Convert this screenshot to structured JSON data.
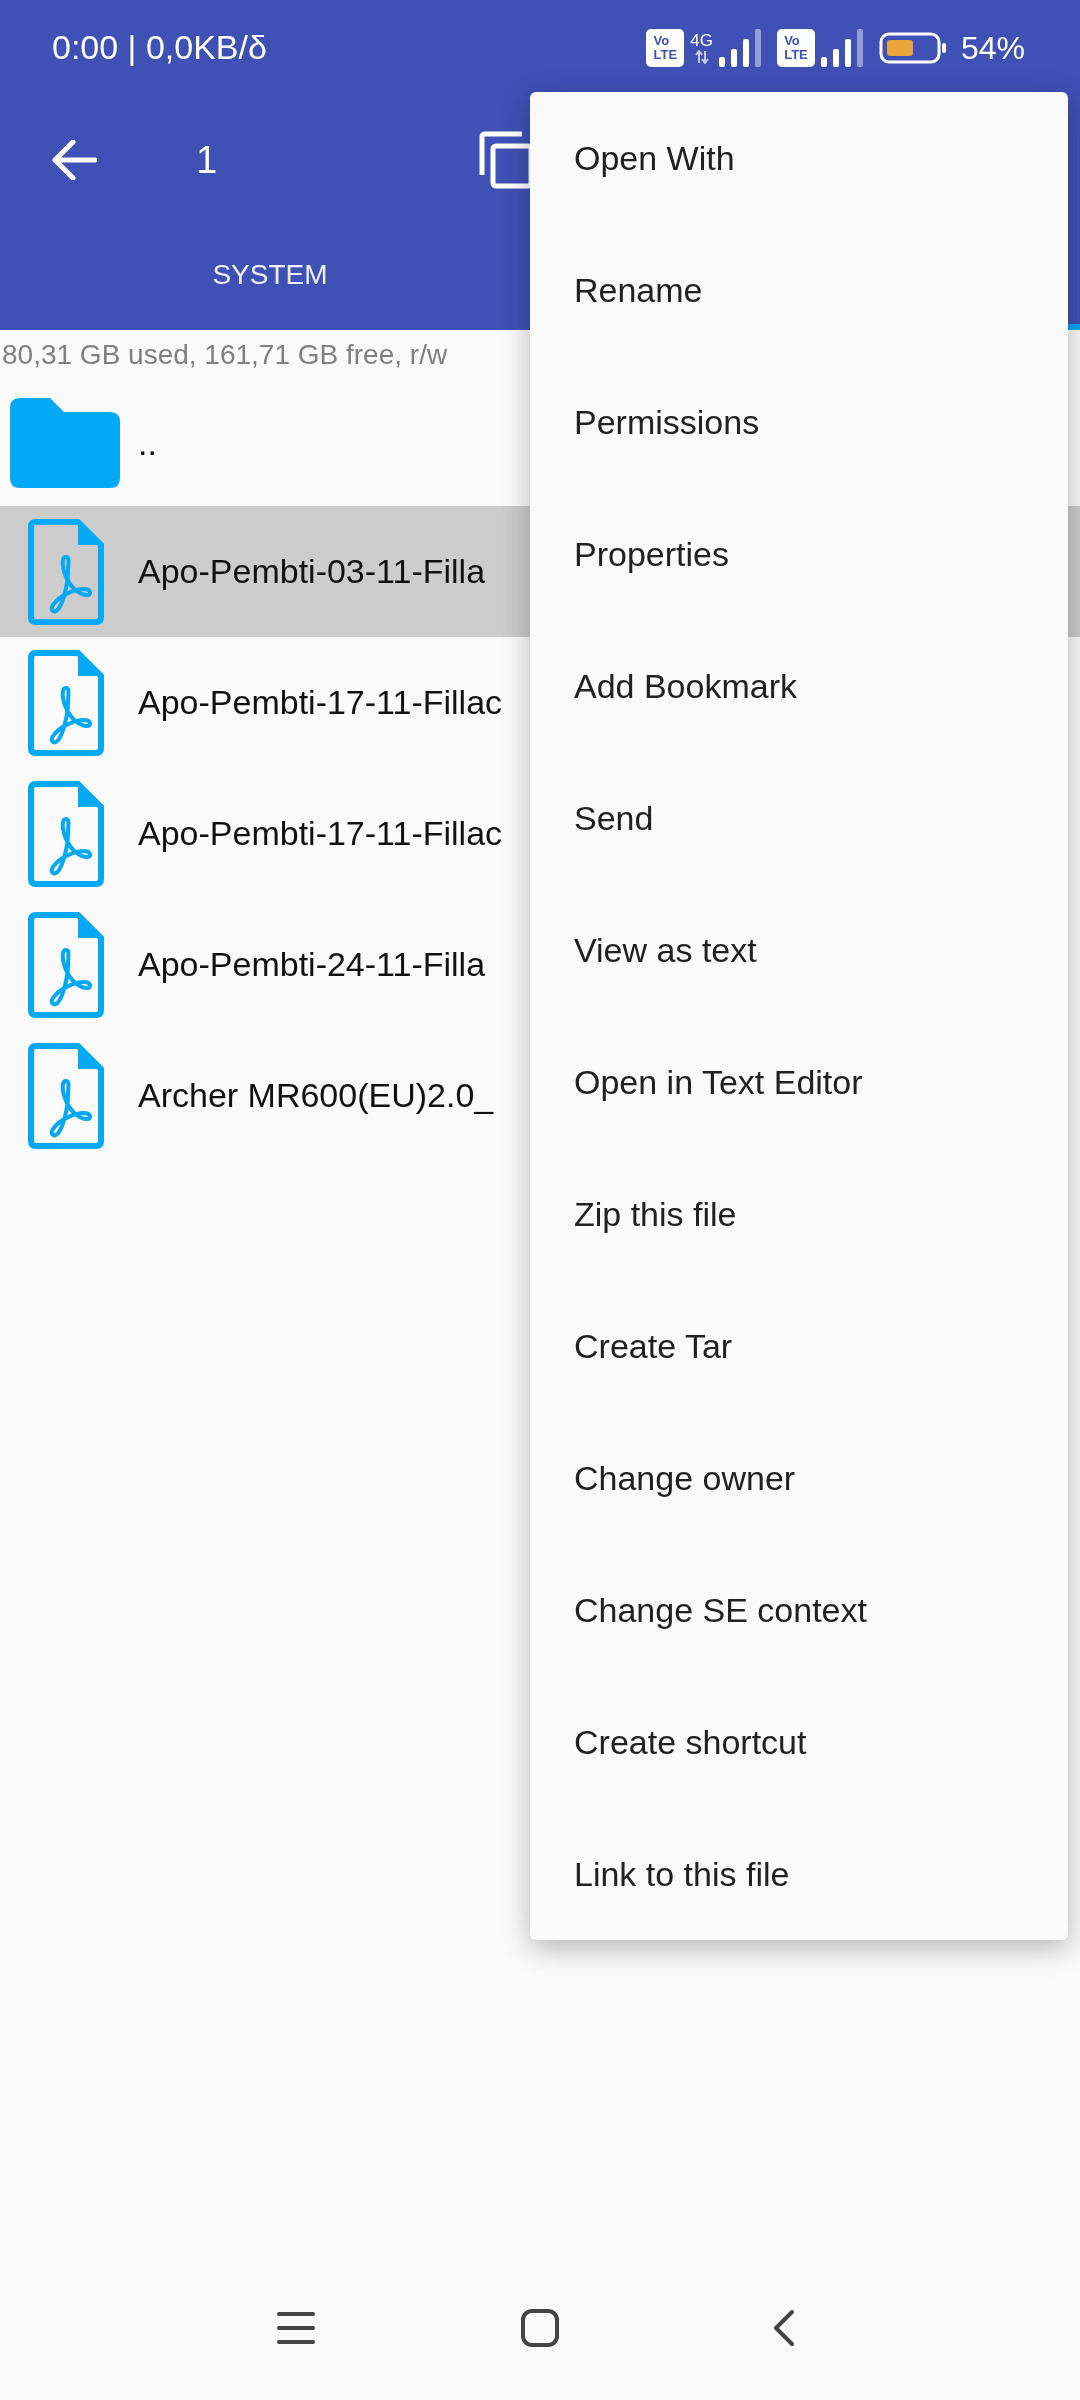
{
  "status_bar": {
    "time_speed": "0:00 | 0,0KB/δ",
    "sims": [
      {
        "badge": [
          "Vo",
          "LTE"
        ],
        "network": "4G"
      },
      {
        "badge": [
          "Vo",
          "LTE"
        ]
      }
    ],
    "battery": "54%"
  },
  "toolbar": {
    "title": "1"
  },
  "tabs": [
    {
      "label": "SYSTEM",
      "selected": false
    },
    {
      "selected": true
    }
  ],
  "file_list": {
    "storage_info": "80,31 GB used, 161,71 GB free, r/w",
    "items": [
      {
        "kind": "folder",
        "name": "..",
        "selected": false
      },
      {
        "kind": "pdf",
        "name": "Apo-Pembti-03-11-Filla",
        "selected": true
      },
      {
        "kind": "pdf",
        "name": "Apo-Pembti-17-11-Fillac",
        "selected": false
      },
      {
        "kind": "pdf",
        "name": "Apo-Pembti-17-11-Fillac",
        "selected": false
      },
      {
        "kind": "pdf",
        "name": "Apo-Pembti-24-11-Filla",
        "selected": false
      },
      {
        "kind": "pdf",
        "name": "Archer MR600(EU)2.0_",
        "selected": false
      }
    ]
  },
  "context_menu": {
    "items": [
      "Open With",
      "Rename",
      "Permissions",
      "Properties",
      "Add Bookmark",
      "Send",
      "View as text",
      "Open in Text Editor",
      "Zip this file",
      "Create Tar",
      "Change owner",
      "Change SE context",
      "Create shortcut",
      "Link to this file"
    ]
  }
}
